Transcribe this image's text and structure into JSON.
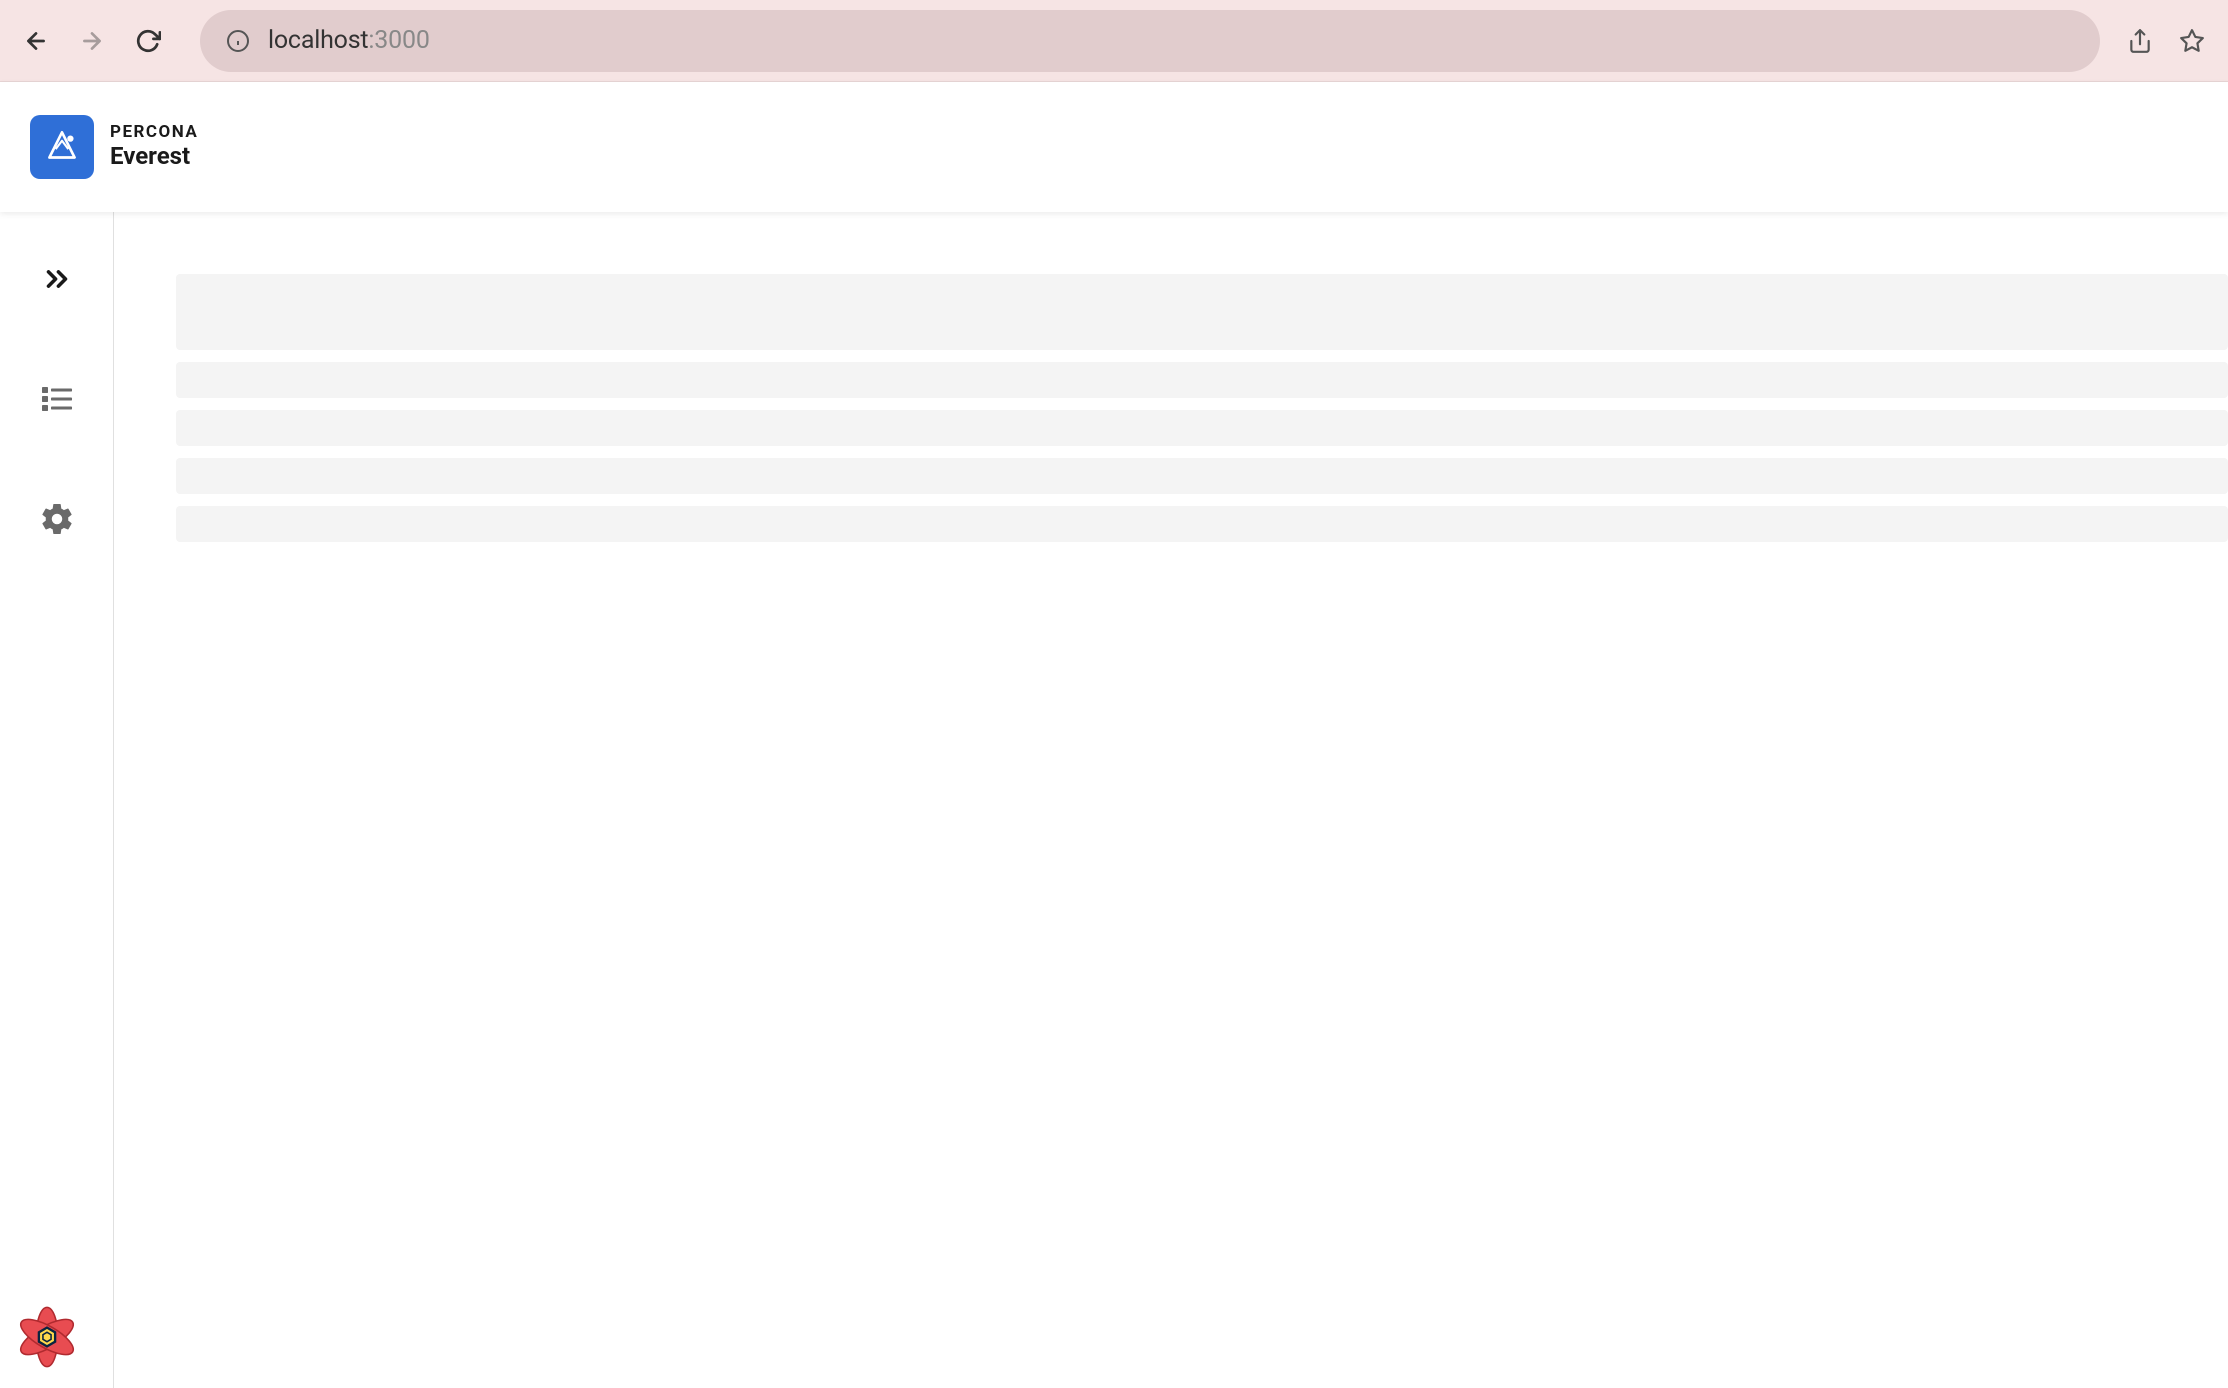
{
  "browser": {
    "url_host": "localhost",
    "url_port": ":3000"
  },
  "header": {
    "brand": "PERCONA",
    "product": "Everest"
  },
  "sidebar": {
    "items": [
      {
        "name": "expand",
        "icon": "chevrons-right"
      },
      {
        "name": "databases",
        "icon": "list"
      },
      {
        "name": "settings",
        "icon": "gear"
      }
    ]
  },
  "content": {
    "skeleton_rows": [
      {
        "size": "large"
      },
      {
        "size": "small"
      },
      {
        "size": "small"
      },
      {
        "size": "small"
      },
      {
        "size": "small"
      }
    ]
  }
}
